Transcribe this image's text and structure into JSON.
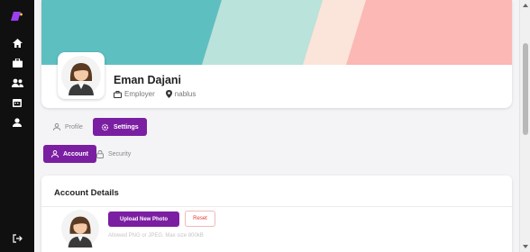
{
  "sidebar": {
    "icons": [
      "logo-icon",
      "home-icon",
      "briefcase-icon",
      "users-icon",
      "calendar-icon",
      "person-icon",
      "logout-icon"
    ]
  },
  "profile": {
    "name": "Eman Dajani",
    "role": "Employer",
    "location": "nablus"
  },
  "tabs": {
    "profile": "Profile",
    "settings": "Settings",
    "active": "settings"
  },
  "subtabs": {
    "account": "Account",
    "security": "Security",
    "active": "account"
  },
  "account_details": {
    "title": "Account Details",
    "upload_label": "Upload New Photo",
    "reset_label": "Reset",
    "hint": "Allowed PNG or JPEG. Max size 800kB"
  },
  "colors": {
    "accent": "#7b1fa2",
    "sidebar": "#101010",
    "banner": [
      "#5ebfc1",
      "#b9e3db",
      "#fbe4da",
      "#fbb8b5"
    ]
  }
}
